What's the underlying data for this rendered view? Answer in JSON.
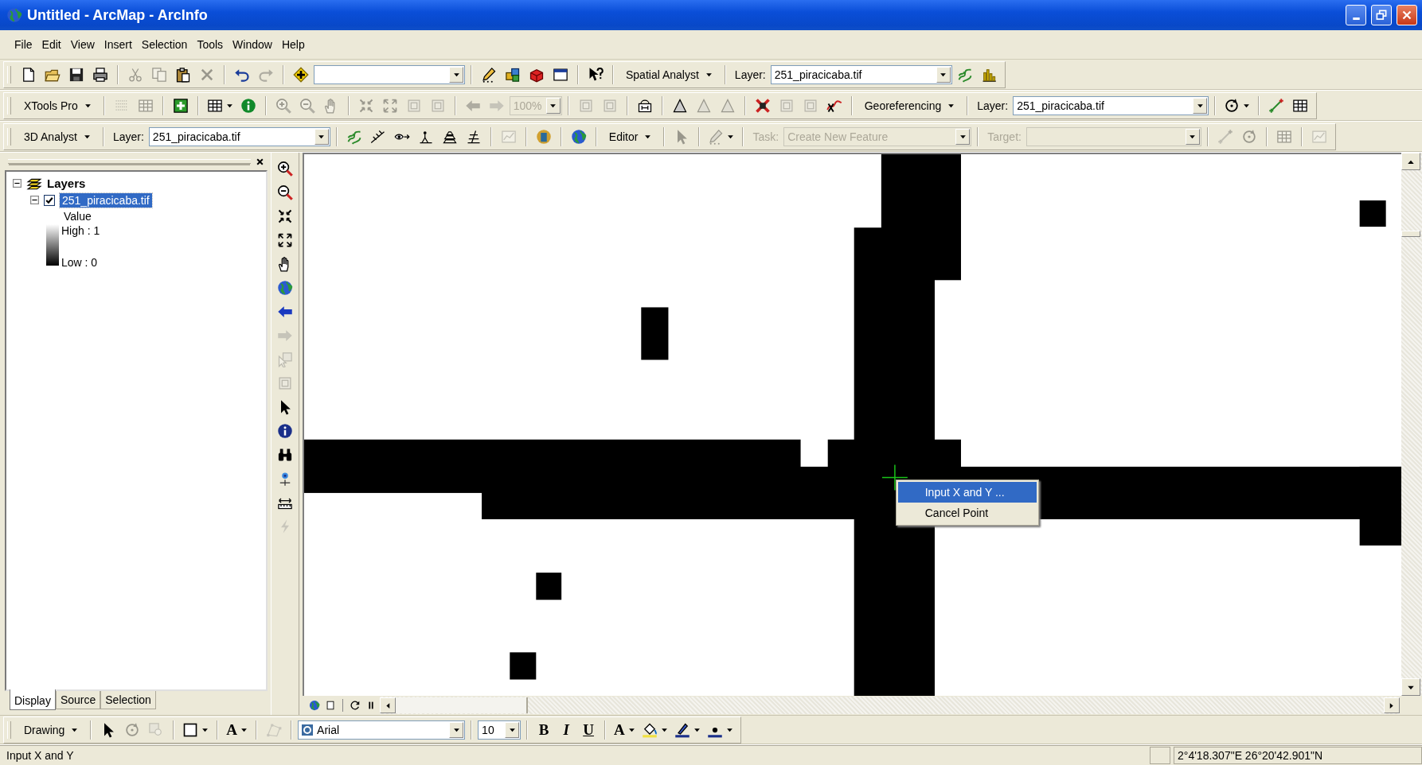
{
  "window": {
    "title": "Untitled - ArcMap - ArcInfo"
  },
  "menu": [
    "File",
    "Edit",
    "View",
    "Insert",
    "Selection",
    "Tools",
    "Window",
    "Help"
  ],
  "toolbars": [
    {
      "groups": [
        [
          {
            "kind": "tool",
            "disabled": false
          },
          {
            "kind": "tool",
            "disabled": false
          },
          {
            "kind": "tool",
            "disabled": false
          },
          {
            "kind": "tool",
            "disabled": false
          }
        ],
        [
          {
            "kind": "tool",
            "disabled": true
          },
          {
            "kind": "tool",
            "disabled": true
          },
          {
            "kind": "tool",
            "disabled": false
          },
          {
            "kind": "tool",
            "disabled": true
          }
        ],
        [
          {
            "kind": "tool",
            "disabled": false
          },
          {
            "kind": "tool",
            "disabled": true
          }
        ],
        [
          {
            "kind": "tool",
            "disabled": false
          },
          {
            "kind": "combo",
            "disabled": false
          }
        ],
        [
          {
            "kind": "tool",
            "disabled": false
          },
          {
            "kind": "tool",
            "disabled": false
          },
          {
            "kind": "tool",
            "disabled": false
          },
          {
            "kind": "tool",
            "disabled": false
          }
        ],
        [
          {
            "kind": "tool",
            "disabled": false
          }
        ],
        [
          {
            "kind": "menu",
            "label": "Spatial Analyst"
          }
        ],
        [
          {
            "kind": "label",
            "text": "Layer:",
            "disabled": false
          },
          {
            "kind": "combo",
            "value": "251_piracicaba.tif",
            "disabled": false
          },
          {
            "kind": "tool",
            "disabled": false
          },
          {
            "kind": "tool",
            "disabled": false
          }
        ]
      ]
    },
    {
      "groups": [
        [
          {
            "kind": "menu",
            "label": "XTools Pro"
          }
        ],
        [
          {
            "kind": "tool",
            "disabled": true
          },
          {
            "kind": "tool",
            "disabled": true
          }
        ],
        [
          {
            "kind": "tool",
            "disabled": false
          }
        ],
        [
          {
            "kind": "tool-menu",
            "disabled": false
          },
          {
            "kind": "tool",
            "disabled": false
          }
        ],
        [
          {
            "kind": "tool",
            "disabled": true
          },
          {
            "kind": "tool",
            "disabled": true
          },
          {
            "kind": "tool",
            "disabled": true
          }
        ],
        [
          {
            "kind": "tool",
            "disabled": true
          },
          {
            "kind": "tool",
            "disabled": true
          },
          {
            "kind": "tool",
            "disabled": true
          },
          {
            "kind": "tool",
            "disabled": true
          }
        ],
        [
          {
            "kind": "tool",
            "disabled": true
          },
          {
            "kind": "tool",
            "disabled": true
          },
          {
            "kind": "combo",
            "value": "100%",
            "disabled": true
          }
        ],
        [
          {
            "kind": "tool",
            "disabled": true
          },
          {
            "kind": "tool",
            "disabled": true
          }
        ],
        [
          {
            "kind": "tool",
            "disabled": false
          }
        ],
        [
          {
            "kind": "tool",
            "disabled": false
          },
          {
            "kind": "tool",
            "disabled": true
          },
          {
            "kind": "tool",
            "disabled": true
          }
        ],
        [
          {
            "kind": "tool",
            "disabled": false
          },
          {
            "kind": "tool",
            "disabled": true
          },
          {
            "kind": "tool",
            "disabled": true
          },
          {
            "kind": "tool",
            "disabled": false
          }
        ],
        [
          {
            "kind": "menu",
            "label": "Georeferencing"
          }
        ],
        [
          {
            "kind": "label",
            "text": "Layer:",
            "disabled": false
          },
          {
            "kind": "combo",
            "value": "251_piracicaba.tif",
            "disabled": false
          }
        ],
        [
          {
            "kind": "tool-menu",
            "disabled": false
          }
        ],
        [
          {
            "kind": "tool",
            "disabled": false
          },
          {
            "kind": "tool",
            "disabled": false
          }
        ]
      ]
    },
    {
      "groups": [
        [
          {
            "kind": "menu",
            "label": "3D Analyst"
          }
        ],
        [
          {
            "kind": "label",
            "text": "Layer:",
            "disabled": false
          },
          {
            "kind": "combo",
            "value": "251_piracicaba.tif",
            "disabled": false
          }
        ],
        [
          {
            "kind": "tool",
            "disabled": false
          },
          {
            "kind": "tool",
            "disabled": false
          },
          {
            "kind": "tool",
            "disabled": false
          },
          {
            "kind": "tool",
            "disabled": false
          },
          {
            "kind": "tool",
            "disabled": false
          },
          {
            "kind": "tool",
            "disabled": false
          }
        ],
        [
          {
            "kind": "tool",
            "disabled": true
          }
        ],
        [
          {
            "kind": "tool",
            "disabled": false
          }
        ],
        [
          {
            "kind": "tool",
            "disabled": false
          }
        ],
        [
          {
            "kind": "menu",
            "label": "Editor"
          }
        ],
        [
          {
            "kind": "tool",
            "disabled": true
          }
        ],
        [
          {
            "kind": "tool-menu",
            "disabled": true
          }
        ],
        [
          {
            "kind": "label",
            "text": "Task:",
            "disabled": true
          },
          {
            "kind": "combo",
            "value": "Create New Feature",
            "disabled": true
          }
        ],
        [
          {
            "kind": "label",
            "text": "Target:",
            "disabled": true
          },
          {
            "kind": "combo",
            "disabled": true
          }
        ],
        [
          {
            "kind": "tool",
            "disabled": true
          },
          {
            "kind": "tool",
            "disabled": true
          }
        ],
        [
          {
            "kind": "tool",
            "disabled": true
          }
        ],
        [
          {
            "kind": "tool",
            "disabled": true
          }
        ]
      ]
    }
  ],
  "toc": {
    "tree": [
      {
        "label": "Layers",
        "expanded": true,
        "children": [
          {
            "label": "251_piracicaba.tif",
            "expanded": true,
            "checked": true,
            "selected": true,
            "legend": {
              "heading": "Value",
              "high": "High : 1",
              "low": "Low : 0"
            }
          }
        ]
      }
    ],
    "tabs": [
      {
        "label": "Display",
        "selected": true
      },
      {
        "label": "Source",
        "selected": false
      },
      {
        "label": "Selection",
        "selected": false
      }
    ]
  },
  "map_tools": [
    {
      "disabled": false
    },
    {
      "disabled": false
    },
    {
      "disabled": false
    },
    {
      "disabled": false
    },
    {
      "disabled": false
    },
    {
      "disabled": false
    },
    {
      "disabled": false
    },
    {
      "disabled": true
    },
    {
      "disabled": true
    },
    {
      "disabled": true
    },
    {
      "disabled": false
    },
    {
      "disabled": false
    },
    {
      "disabled": false
    },
    {
      "disabled": false
    },
    {
      "disabled": false
    },
    {
      "disabled": true
    }
  ],
  "context_menu": [
    {
      "label": "Input X and Y ...",
      "selected": true
    },
    {
      "label": "Cancel Point",
      "selected": false
    }
  ],
  "drawing_toolbar": {
    "groups": [
      [
        {
          "kind": "menu",
          "label": "Drawing"
        }
      ],
      [
        {
          "kind": "tool",
          "disabled": false
        },
        {
          "kind": "tool",
          "disabled": true
        },
        {
          "kind": "tool",
          "disabled": true
        }
      ],
      [
        {
          "kind": "tool-menu",
          "disabled": false
        }
      ],
      [
        {
          "kind": "glyph-menu",
          "text": "A"
        }
      ],
      [
        {
          "kind": "tool",
          "disabled": true
        }
      ],
      [
        {
          "kind": "font-combo",
          "value": "Arial",
          "disabled": false
        }
      ],
      [
        {
          "kind": "combo",
          "value": "10",
          "disabled": false
        }
      ],
      [
        {
          "kind": "bold",
          "text": "B"
        },
        {
          "kind": "italic",
          "text": "I"
        },
        {
          "kind": "underline",
          "text": "U"
        }
      ],
      [
        {
          "kind": "glyph-menu",
          "text": "A"
        },
        {
          "kind": "tool-menu",
          "disabled": false
        },
        {
          "kind": "tool-menu",
          "disabled": false
        },
        {
          "kind": "tool-menu",
          "disabled": false
        }
      ]
    ]
  },
  "status_bar": {
    "message": "Input X and Y",
    "coordinates": "2°4'18.307\"E  26°20'42.901\"N"
  }
}
